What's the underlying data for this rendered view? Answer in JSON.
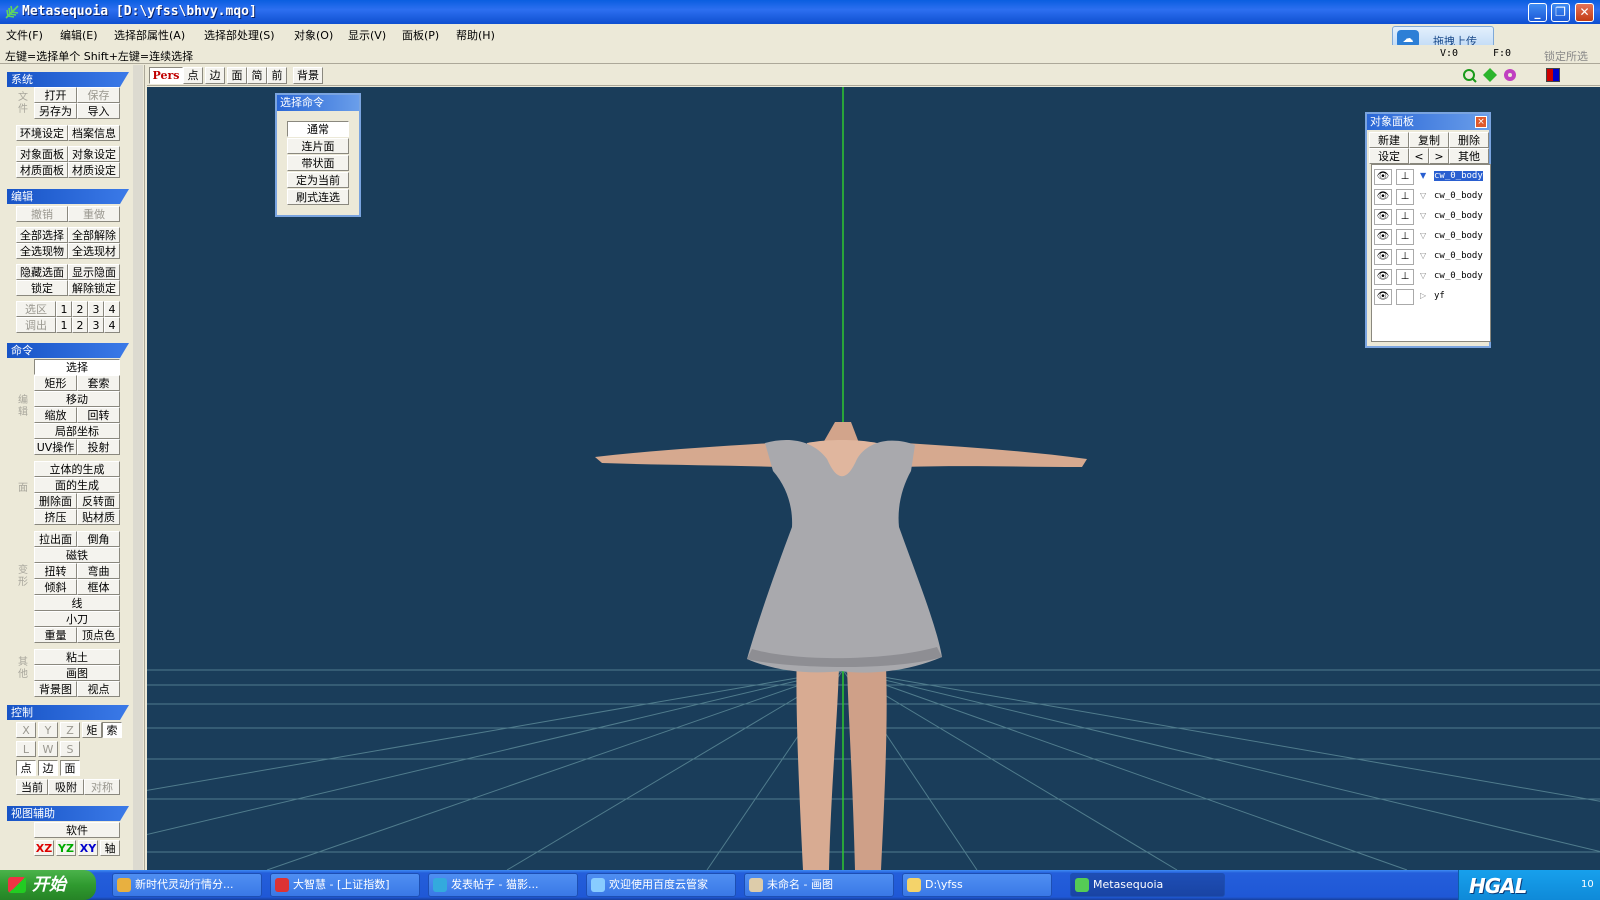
{
  "window": {
    "title": "Metasequoia [D:\\yfss\\bhvy.mqo]",
    "minimize": "_",
    "restore": "❐",
    "close": "✕"
  },
  "menu": [
    "文件(F)",
    "编辑(E)",
    "选择部属性(A)",
    "选择部处理(S)",
    "对象(O)",
    "显示(V)",
    "面板(P)",
    "帮助(H)"
  ],
  "upload_button": "拖拽上传",
  "status": {
    "hint": "左键=选择单个  Shift+左键=连续选择",
    "v": "V:0",
    "f": "F:0",
    "lock": "锁定所选"
  },
  "left_panel": {
    "system": {
      "title": "系统",
      "side_label": "文件",
      "open": "打开",
      "save": "保存",
      "save_as": "另存为",
      "import": "导入",
      "env": "环境设定",
      "info": "档案信息",
      "obj_panel": "对象面板",
      "obj_set": "对象设定",
      "mat_panel": "材质面板",
      "mat_set": "材质设定"
    },
    "edit": {
      "title": "编辑",
      "undo": "撤销",
      "redo": "重做",
      "sel_all": "全部选择",
      "desel_all": "全部解除",
      "sel_obj": "全选现物",
      "sel_mat": "全选现材",
      "hide": "隐藏选面",
      "show": "显示隐面",
      "lock": "锁定",
      "unlock": "解除锁定",
      "sel_area": "选区",
      "sel_tune": "调出",
      "nums": [
        "1",
        "2",
        "3",
        "4"
      ]
    },
    "command": {
      "title": "命令",
      "edit_label": "编辑",
      "select": "选择",
      "rect": "矩形",
      "lasso": "套索",
      "move": "移动",
      "scale": "缩放",
      "rotate": "回转",
      "local": "局部坐标",
      "uv": "UV操作",
      "project": "投射",
      "face_label": "面",
      "solid": "立体的生成",
      "face": "面的生成",
      "del_face": "删除面",
      "flip": "反转面",
      "extrude": "挤压",
      "paint_mat": "贴材质",
      "deform_label": "变形",
      "pull": "拉出面",
      "chamfer": "倒角",
      "magnet": "磁铁",
      "twist": "扭转",
      "bend": "弯曲",
      "tilt": "倾斜",
      "lattice": "框体",
      "line": "线",
      "knife": "小刀",
      "weight": "重量",
      "vcolor": "顶点色",
      "other_label": "其他",
      "clay": "粘土",
      "paint": "画图",
      "bg": "背景图",
      "view": "视点"
    },
    "control": {
      "title": "控制",
      "x": "X",
      "y": "Y",
      "z": "Z",
      "rect": "矩",
      "lasso": "索",
      "l": "L",
      "w": "W",
      "s": "S",
      "point": "点",
      "edge": "边",
      "face": "面",
      "current": "当前",
      "snap": "吸附",
      "sym": "对称"
    },
    "view_assist": {
      "title": "视图辅助",
      "soft": "软件",
      "xz": "XZ",
      "yz": "YZ",
      "xy": "XY",
      "axis": "轴"
    }
  },
  "viewport_toolbar": [
    "Pers",
    "点",
    "边",
    "面",
    "简",
    "前",
    "背景"
  ],
  "select_cmd_panel": {
    "title": "选择命令",
    "buttons": [
      "通常",
      "连片面",
      "带状面",
      "定为当前",
      "刷式连选"
    ]
  },
  "object_panel": {
    "title": "对象面板",
    "close": "×",
    "buttons_row1": [
      "新建",
      "复制",
      "删除"
    ],
    "buttons_row2": [
      "设定",
      "<",
      ">",
      "其他"
    ],
    "objects": [
      {
        "name": "cw_0_body",
        "selected": true
      },
      {
        "name": "cw_0_body",
        "selected": false
      },
      {
        "name": "cw_0_body",
        "selected": false
      },
      {
        "name": "cw_0_body",
        "selected": false
      },
      {
        "name": "cw_0_body",
        "selected": false
      },
      {
        "name": "cw_0_body",
        "selected": false
      },
      {
        "name": "yf",
        "selected": false
      }
    ]
  },
  "taskbar": {
    "start": "开始",
    "tasks": [
      "新时代灵动行情分...",
      "大智慧 - [上证指数]",
      "发表帖子 - 猫影...",
      "欢迎使用百度云管家",
      "未命名 - 画图",
      "D:\\yfss",
      "Metasequoia"
    ],
    "tray_logo": "HGAL",
    "clock": "10"
  },
  "colors": {
    "viewport_bg": "#1a3d5a",
    "grid": "#5a8896",
    "axis_y": "#2ec82e",
    "model_skin": "#d8ab92",
    "model_dress": "#a9a9ad"
  }
}
